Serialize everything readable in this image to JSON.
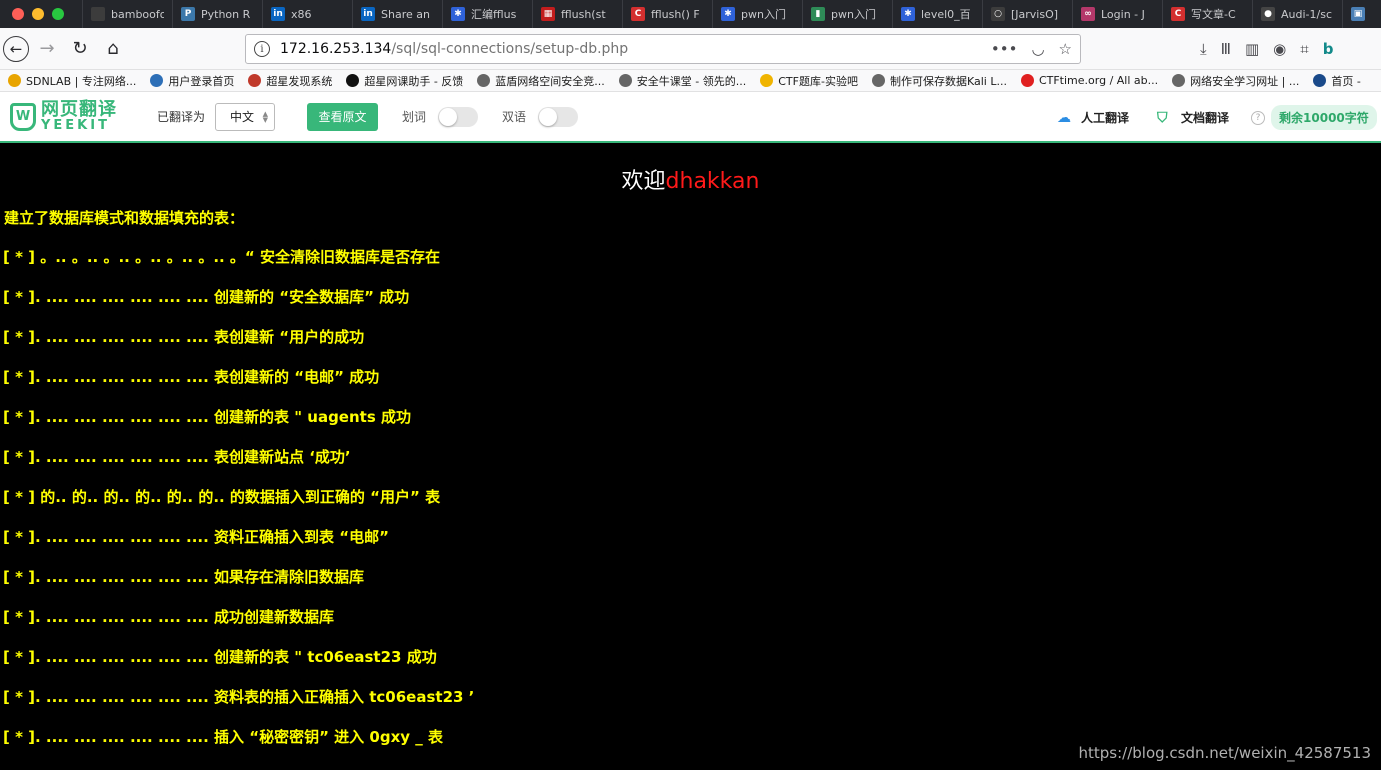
{
  "browser": {
    "tabs": [
      {
        "title": "bamboofox o",
        "color": "#3c3c3c",
        "glyph": ""
      },
      {
        "title": "Python R",
        "color": "#3c78aa",
        "glyph": "P"
      },
      {
        "title": "x86",
        "color": "#0a66c2",
        "glyph": "in"
      },
      {
        "title": "Share an",
        "color": "#0a66c2",
        "glyph": "in"
      },
      {
        "title": "汇编fflus",
        "color": "#2f62d8",
        "glyph": "✱"
      },
      {
        "title": "fflush(st",
        "color": "#c21d1d",
        "glyph": "▦"
      },
      {
        "title": "fflush() F",
        "color": "#d32f2f",
        "glyph": "C"
      },
      {
        "title": "pwn入门",
        "color": "#2f62d8",
        "glyph": "✱"
      },
      {
        "title": "pwn入门",
        "color": "#2e8b57",
        "glyph": "▮"
      },
      {
        "title": "level0_百",
        "color": "#2f62d8",
        "glyph": "✱"
      },
      {
        "title": "[JarvisO]",
        "color": "#3c3c3c",
        "glyph": "○"
      },
      {
        "title": "Login - J",
        "color": "#b4386a",
        "glyph": "∞"
      },
      {
        "title": "写文章-C",
        "color": "#d32f2f",
        "glyph": "C"
      },
      {
        "title": "Audi-1/sc",
        "color": "#444",
        "glyph": "●"
      },
      {
        "title": "",
        "color": "#4a7fb5",
        "glyph": "▣"
      }
    ],
    "url": {
      "host": "172.16.253.134",
      "path": "/sql/sql-connections/setup-db.php"
    },
    "icons": {
      "back": "back-arrow-icon",
      "forward": "forward-arrow-icon",
      "reload": "reload-icon",
      "home": "home-icon",
      "info": "site-info-icon",
      "more": "page-actions-icon",
      "pocket": "pocket-icon",
      "star": "bookmark-star-icon",
      "download": "download-icon",
      "library": "library-icon",
      "sidebar": "sidebar-icon",
      "account": "account-icon",
      "screenshot": "screenshot-icon",
      "bing": "bing-icon"
    },
    "bookmarks": [
      {
        "title": "SDNLAB | 专注网络...",
        "color": "#e8a400"
      },
      {
        "title": "用户登录首页",
        "color": "#2d6fb7"
      },
      {
        "title": "超星发现系统",
        "color": "#c0392b"
      },
      {
        "title": "超星网课助手 - 反馈",
        "color": "#111"
      },
      {
        "title": "蓝盾网络空间安全竞...",
        "color": "#666"
      },
      {
        "title": "安全牛课堂 - 领先的...",
        "color": "#666"
      },
      {
        "title": "CTF题库-实验吧",
        "color": "#f0b400"
      },
      {
        "title": "制作可保存数据Kali L...",
        "color": "#666"
      },
      {
        "title": "CTFtime.org / All ab...",
        "color": "#e02020"
      },
      {
        "title": "网络安全学习网址 | ...",
        "color": "#666"
      },
      {
        "title": "首页 -",
        "color": "#1a4a8a"
      }
    ]
  },
  "translator": {
    "logo_cn": "网页翻译",
    "logo_en": "YEEKIT",
    "translated_to_label": "已翻译为",
    "language": "中文",
    "view_original": "查看原文",
    "word_pick": "划词",
    "bilingual": "双语",
    "human_translation": "人工翻译",
    "doc_translation": "文档翻译",
    "help": "?",
    "quota": "剩余10000字符",
    "accent": "#38b77a"
  },
  "page": {
    "welcome_prefix": "欢迎",
    "welcome_user": "dhakkan",
    "intro": "建立了数据库模式和数据填充的表：",
    "lines": [
      "[ * ] 。.. 。.. 。.. 。.. 。.. 。.. 。“ 安全清除旧数据库是否存在",
      "[ * ]. .... .... .... .... .... .... 创建新的 “安全数据库” 成功",
      "[ * ]. .... .... .... .... .... .... 表创建新 “用户的成功",
      "[ * ]. .... .... .... .... .... .... 表创建新的 “电邮” 成功",
      "[ * ]. .... .... .... .... .... .... 创建新的表 \" uagents 成功",
      "[ * ]. .... .... .... .... .... .... 表创建新站点 ‘成功’",
      "[ * ] 的.. 的.. 的.. 的.. 的.. 的.. 的数据插入到正确的 “用户” 表",
      "[ * ]. .... .... .... .... .... .... 资料正确插入到表 “电邮”",
      "[ * ]. .... .... .... .... .... .... 如果存在清除旧数据库",
      "[ * ]. .... .... .... .... .... .... 成功创建新数据库",
      "[ * ]. .... .... .... .... .... .... 创建新的表 \" tc06east23 成功",
      "[ * ]. .... .... .... .... .... .... 资料表的插入正确插入 tc06east23 ’",
      "[ * ]. .... .... .... .... .... .... 插入 “秘密密钥” 进入 0gxy _ 表"
    ],
    "watermark": "https://blog.csdn.net/weixin_42587513",
    "text_color": "#ffff00",
    "user_color": "#ff1a1a"
  }
}
